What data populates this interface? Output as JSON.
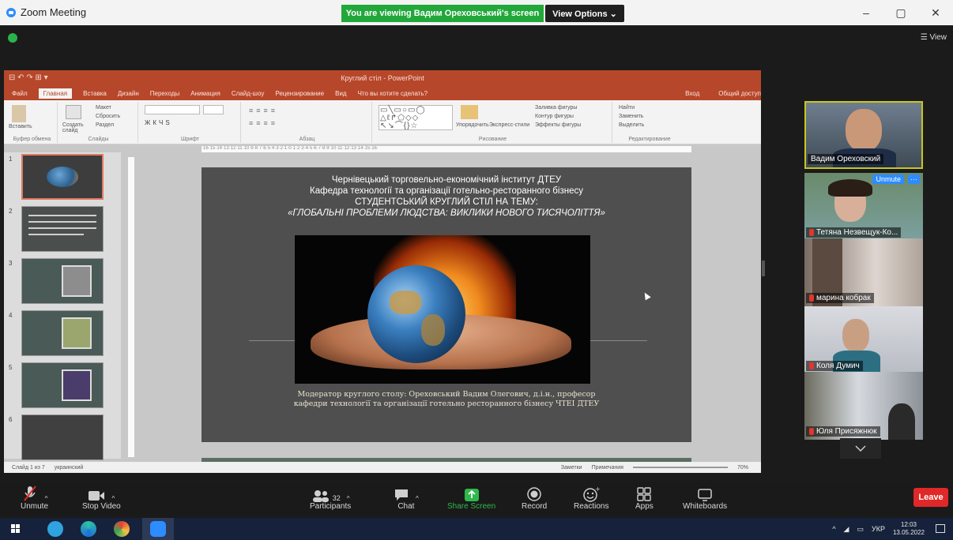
{
  "window": {
    "title": "Zoom Meeting",
    "min": "–",
    "max": "▢",
    "close": "✕"
  },
  "banner": {
    "viewing": "You are viewing Вадим Ореховський's screen",
    "view_options": "View Options ⌄"
  },
  "stage": {
    "view_label": "☰ View"
  },
  "ppt": {
    "quick_access": "⊟ ↶ ↷ ⊞ ▾",
    "title": "Круглий стіл - PowerPoint",
    "tabs": [
      "Файл",
      "Главная",
      "Вставка",
      "Дизайн",
      "Переходы",
      "Анимация",
      "Слайд-шоу",
      "Рецензирование",
      "Вид",
      "Что вы хотите сделать?"
    ],
    "login": "Вход",
    "share": "Общий доступ",
    "ribbon_groups": [
      "Буфер обмена",
      "Слайды",
      "Шрифт",
      "Абзац",
      "Рисование",
      "Редактирование"
    ],
    "ribbon_items": {
      "paste": "Вставить",
      "create": "Создать слайд",
      "layout": "Макет",
      "reset": "Сбросить",
      "section": "Раздел",
      "arrange": "Упорядочить",
      "quick_styles": "Экспресс-стили",
      "fill": "Заливка фигуры",
      "outline": "Контур фигуры",
      "effects": "Эффекты фигуры",
      "find": "Найти",
      "replace": "Заменить",
      "select": "Выделить"
    },
    "ruler": "·16·15·14·13·12·11·10·9·8·7·6·5·4·3·2·1·0·1·2·3·4·5·6·7·8·9·10·11·12·13·14·15·16·",
    "slide_nums": [
      "1",
      "2",
      "3",
      "4",
      "5",
      "6"
    ],
    "slide": {
      "line1": "Чернівецький торговельно-економічний інститут ДТЕУ",
      "line2": "Кафедра технології та організації готельно-ресторанного бізнесу",
      "line3": "СТУДЕНТСЬКИЙ КРУГЛИЙ СТІЛ НА ТЕМУ:",
      "line4": "«ГЛОБАЛЬНІ ПРОБЛЕМИ ЛЮДСТВА: ВИКЛИКИ НОВОГО ТИСЯЧОЛІТТЯ»",
      "moderator1": "Модератор круглого столу: Ореховський Вадим Олегович, д.і.н., професор",
      "moderator2": "кафедри технології та організації готельно ресторанного бізнесу ЧТЕІ ДТЕУ"
    },
    "status": {
      "slide": "Слайд 1 из 7",
      "lang": "украинский",
      "notes": "Заметки",
      "comments": "Примечания",
      "zoom": "70%"
    }
  },
  "participants_panel": [
    {
      "name": "Вадим Ореховский",
      "muted": false,
      "active": true
    },
    {
      "name": "Тетяна Незвещук-Ко...",
      "muted": true,
      "unmute": "Unmute",
      "more": "···"
    },
    {
      "name": "марина кобрак",
      "muted": true
    },
    {
      "name": "Коля Думич",
      "muted": true
    },
    {
      "name": "Юля Присяжнюк",
      "muted": true
    }
  ],
  "toolbar": {
    "unmute": "Unmute",
    "stop_video": "Stop Video",
    "participants": "Participants",
    "participants_count": "32",
    "chat": "Chat",
    "share_screen": "Share Screen",
    "record": "Record",
    "reactions": "Reactions",
    "apps": "Apps",
    "whiteboards": "Whiteboards",
    "leave": "Leave"
  },
  "taskbar": {
    "lang": "УКР",
    "time": "12:03",
    "date": "13.05.2022",
    "tray_arrow": "^"
  },
  "colors": {
    "ppt_red": "#b7472a",
    "zoom_green": "#22a83a",
    "leave_red": "#e02828",
    "active_border": "#c9c51e"
  }
}
